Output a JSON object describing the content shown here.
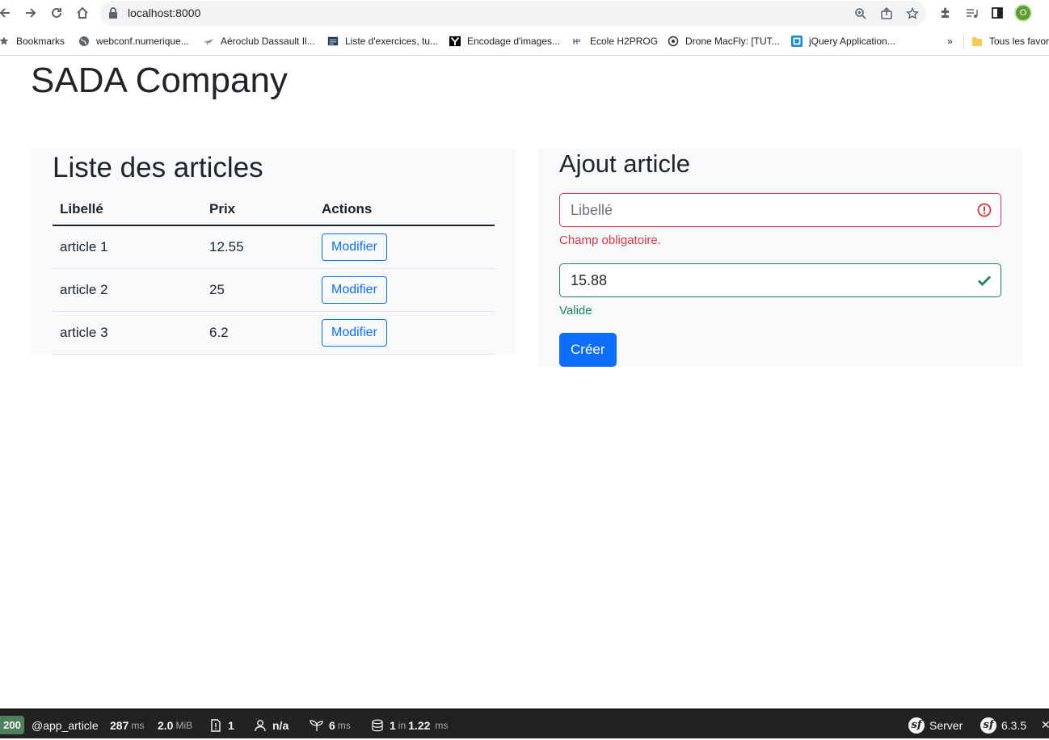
{
  "browser": {
    "url": "localhost:8000",
    "profile_initial": "O",
    "bookmarks": [
      {
        "label": "Bookmarks",
        "icon": "star-icon"
      },
      {
        "label": "webconf.numerique...",
        "icon": "globe-icon"
      },
      {
        "label": "Aéroclub Dassault Il...",
        "icon": "plane-icon"
      },
      {
        "label": "Liste d'exercices, tu...",
        "icon": "doc-icon"
      },
      {
        "label": "Encodage d'images...",
        "icon": "y-logo-icon"
      },
      {
        "label": "Ecole H2PROG",
        "icon": "h2prog-icon"
      },
      {
        "label": "Drone MacFly: [TUT...",
        "icon": "drone-icon"
      },
      {
        "label": "jQuery Application...",
        "icon": "jquery-icon"
      }
    ],
    "overflow": "»",
    "folder_label": "Tous les favoris"
  },
  "page": {
    "title": "SADA Company"
  },
  "list": {
    "heading": "Liste des articles",
    "headers": [
      "Libellé",
      "Prix",
      "Actions"
    ],
    "rows": [
      {
        "libelle": "article 1",
        "prix": "12.55",
        "action": "Modifier"
      },
      {
        "libelle": "article 2",
        "prix": "25",
        "action": "Modifier"
      },
      {
        "libelle": "article 3",
        "prix": "6.2",
        "action": "Modifier"
      }
    ]
  },
  "form": {
    "heading": "Ajout article",
    "libelle_placeholder": "Libellé",
    "libelle_value": "",
    "libelle_error": "Champ obligatoire.",
    "prix_value": "15.88",
    "prix_feedback": "Valide",
    "submit_label": "Créer"
  },
  "colors": {
    "primary": "#0d6efd",
    "danger": "#dc3545",
    "success": "#198754",
    "panel_bg": "#f8f9fa"
  },
  "debug_bar": {
    "status": "200",
    "route": "@app_article",
    "time_value": "287",
    "time_unit": "ms",
    "memory_value": "2.0",
    "memory_unit": "MiB",
    "logs": "1",
    "user": "n/a",
    "init_value": "6",
    "init_unit": "ms",
    "db_queries": "1",
    "db_in": "in",
    "db_time": "1.22",
    "db_unit": "ms",
    "server_label": "Server",
    "version": "6.3.5",
    "close": "✕"
  }
}
